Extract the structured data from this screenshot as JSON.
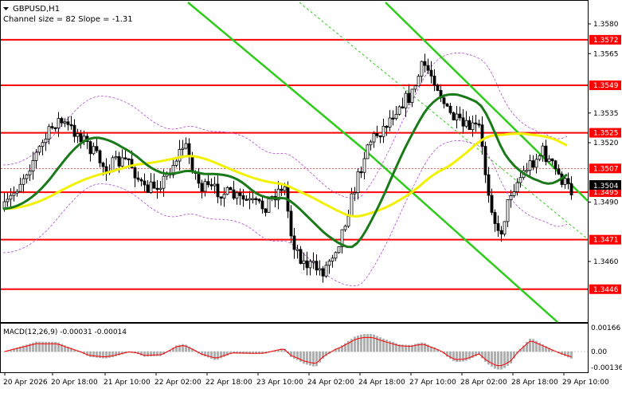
{
  "main": {
    "symbol": "GBPUSD,H1",
    "channel_info": "Channel size = 82 Slope = -1.31",
    "price_axis": [
      "1.3580",
      "1.3565",
      "1.3535",
      "1.3520",
      "1.3490",
      "1.3460"
    ],
    "levels": [
      {
        "label": "1.3572",
        "price": 1.3572,
        "color": "#ff0000"
      },
      {
        "label": "1.3549",
        "price": 1.3549,
        "color": "#ff0000"
      },
      {
        "label": "1.3525",
        "price": 1.3525,
        "color": "#ff0000"
      },
      {
        "label": "1.3495",
        "price": 1.3495,
        "color": "#ff0000"
      },
      {
        "label": "1.3471",
        "price": 1.3471,
        "color": "#ff0000"
      },
      {
        "label": "1.3446",
        "price": 1.3446,
        "color": "#ff0000"
      }
    ],
    "current_price": {
      "label": "1.3504",
      "price": 1.3504
    },
    "bid_price": {
      "label": "1.3507",
      "price": 1.3507
    },
    "colors": {
      "candles": "#000000",
      "ma_fast": "#1a7a1a",
      "ma_slow": "#f2f200",
      "channel": "#2ecc1a",
      "envelope": "#b050d0"
    }
  },
  "macd": {
    "label": "MACD(12,26,9) -0.00031 -0.00014",
    "axis": [
      "0.00166",
      "0.00",
      "-0.00136"
    ]
  },
  "time_axis": [
    "20 Apr 2026",
    "20 Apr 18:00",
    "21 Apr 10:00",
    "22 Apr 02:00",
    "22 Apr 18:00",
    "23 Apr 10:00",
    "24 Apr 02:00",
    "24 Apr 18:00",
    "27 Apr 10:00",
    "28 Apr 02:00",
    "28 Apr 18:00",
    "29 Apr 10:00"
  ]
}
